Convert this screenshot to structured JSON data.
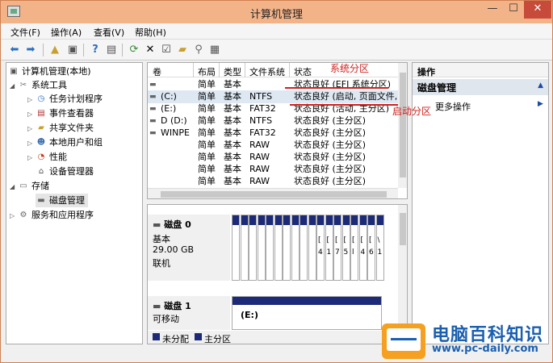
{
  "window": {
    "title": "计算机管理"
  },
  "menu": [
    "文件(F)",
    "操作(A)",
    "查看(V)",
    "帮助(H)"
  ],
  "tree": {
    "items": [
      {
        "label": "计算机管理(本地)",
        "icon": "computer-management-icon"
      },
      {
        "label": "系统工具",
        "icon": "tools-icon"
      },
      {
        "label": "任务计划程序",
        "icon": "clock-icon"
      },
      {
        "label": "事件查看器",
        "icon": "event-viewer-icon"
      },
      {
        "label": "共享文件夹",
        "icon": "shared-folder-icon"
      },
      {
        "label": "本地用户和组",
        "icon": "users-icon"
      },
      {
        "label": "性能",
        "icon": "performance-icon"
      },
      {
        "label": "设备管理器",
        "icon": "device-manager-icon"
      },
      {
        "label": "存储",
        "icon": "storage-icon"
      },
      {
        "label": "磁盘管理",
        "icon": "disk-icon"
      },
      {
        "label": "服务和应用程序",
        "icon": "services-icon"
      }
    ]
  },
  "volumes": {
    "headers": {
      "volume": "卷",
      "layout": "布局",
      "type": "类型",
      "fs": "文件系统",
      "status": "状态"
    },
    "rows": [
      {
        "volume": "",
        "layout": "简单",
        "type": "基本",
        "fs": "",
        "status": "状态良好 (EFI 系统分区)"
      },
      {
        "volume": "(C:)",
        "layout": "简单",
        "type": "基本",
        "fs": "NTFS",
        "status": "状态良好 (启动, 页面文件,"
      },
      {
        "volume": "(E:)",
        "layout": "简单",
        "type": "基本",
        "fs": "FAT32",
        "status": "状态良好 (活动, 主分区)"
      },
      {
        "volume": "D (D:)",
        "layout": "简单",
        "type": "基本",
        "fs": "NTFS",
        "status": "状态良好 (主分区)"
      },
      {
        "volume": "WINPE",
        "layout": "简单",
        "type": "基本",
        "fs": "FAT32",
        "status": "状态良好 (主分区)"
      },
      {
        "volume": "",
        "layout": "简单",
        "type": "基本",
        "fs": "RAW",
        "status": "状态良好 (主分区)"
      },
      {
        "volume": "",
        "layout": "简单",
        "type": "基本",
        "fs": "RAW",
        "status": "状态良好 (主分区)"
      },
      {
        "volume": "",
        "layout": "简单",
        "type": "基本",
        "fs": "RAW",
        "status": "状态良好 (主分区)"
      },
      {
        "volume": "",
        "layout": "简单",
        "type": "基本",
        "fs": "RAW",
        "status": "状态良好 (主分区)"
      }
    ]
  },
  "disk0": {
    "name": "磁盘 0",
    "kind": "基本",
    "size": "29.00 GB",
    "state": "联机"
  },
  "disk0_part_texts": [
    {
      "l1": "",
      "l2": ""
    },
    {
      "l1": "",
      "l2": ""
    },
    {
      "l1": "",
      "l2": ""
    },
    {
      "l1": "",
      "l2": ""
    },
    {
      "l1": "",
      "l2": ""
    },
    {
      "l1": "",
      "l2": ""
    },
    {
      "l1": "",
      "l2": ""
    },
    {
      "l1": "",
      "l2": ""
    },
    {
      "l1": "",
      "l2": ""
    },
    {
      "l1": "",
      "l2": ""
    },
    {
      "l1": "[",
      "l2": "4"
    },
    {
      "l1": "[",
      "l2": "1"
    },
    {
      "l1": "[",
      "l2": "7"
    },
    {
      "l1": "[",
      "l2": "5"
    },
    {
      "l1": "[",
      "l2": "l"
    },
    {
      "l1": "[",
      "l2": "4"
    },
    {
      "l1": "[",
      "l2": "6"
    },
    {
      "l1": "\\",
      "l2": "1"
    }
  ],
  "disk1": {
    "name": "磁盘 1",
    "kind": "可移动",
    "partition": "(E:)"
  },
  "legend": {
    "unallocated": "未分配",
    "primary": "主分区"
  },
  "actions": {
    "header": "操作",
    "section": "磁盘管理",
    "more": "更多操作"
  },
  "annotations": {
    "system_partition": "系统分区",
    "boot_partition": "启动分区"
  },
  "watermark": {
    "site_name": "电脑百科知识",
    "url": "www.pc-daily.com"
  },
  "colors": {
    "partition_bar": "#1c2a78",
    "annotation": "#d0201c",
    "titlebar": "#f3b389",
    "watermark": "#1b5fb0"
  }
}
